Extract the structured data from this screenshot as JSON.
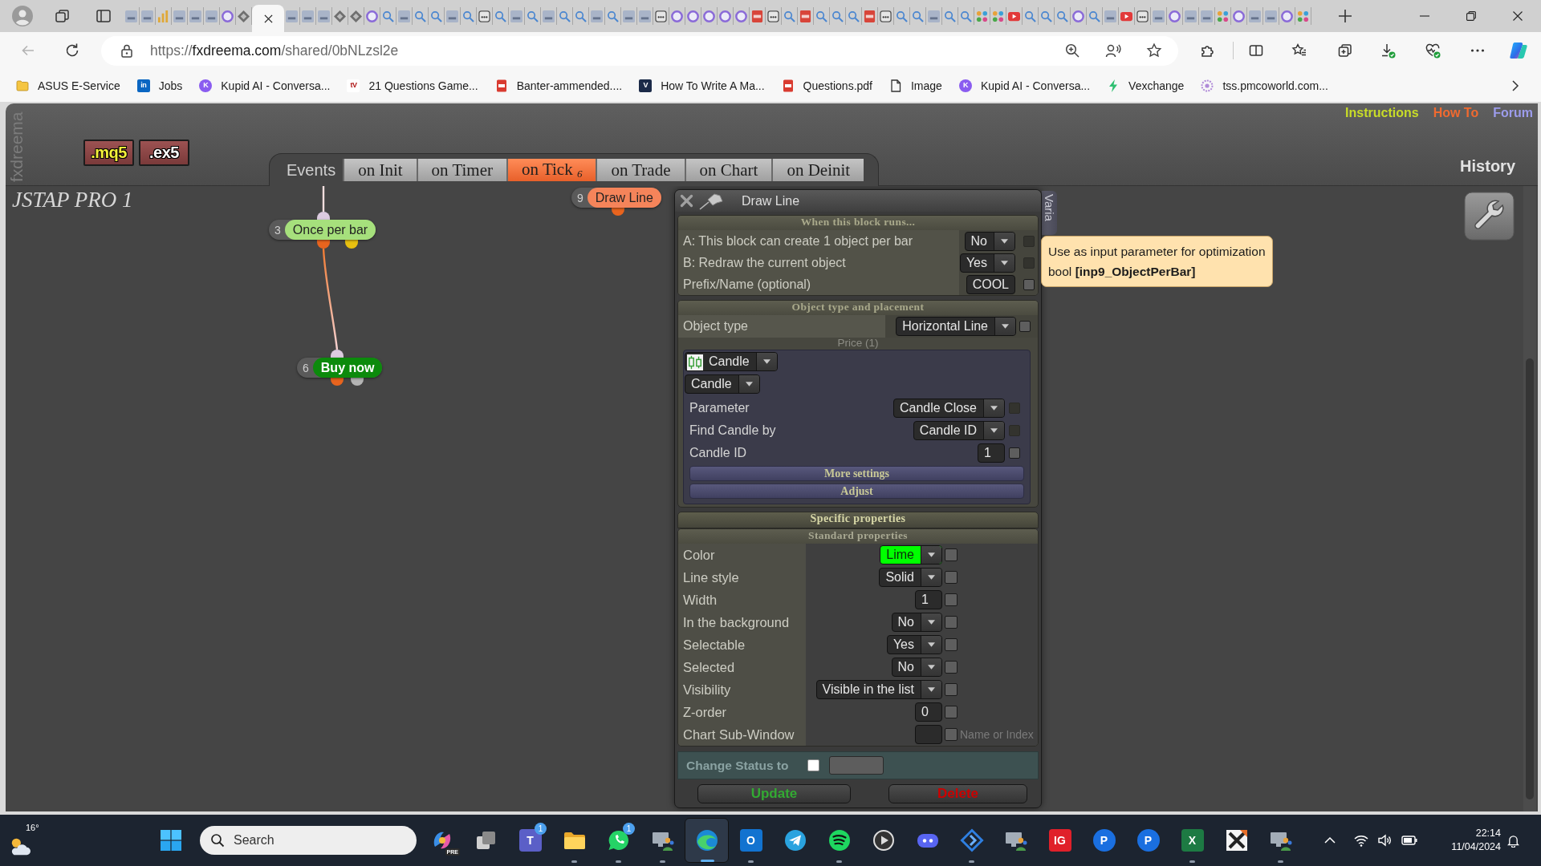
{
  "browser": {
    "tabs": [
      {
        "kind": "tile",
        "selected": false
      },
      {
        "kind": "tile",
        "selected": false
      },
      {
        "kind": "chart",
        "selected": false
      },
      {
        "kind": "tile",
        "selected": false
      },
      {
        "kind": "tile",
        "selected": false
      },
      {
        "kind": "tile",
        "selected": false
      },
      {
        "kind": "ring",
        "selected": false
      },
      {
        "kind": "diamond",
        "selected": false
      },
      {
        "selected": true
      },
      {
        "kind": "tile",
        "selected": false
      },
      {
        "kind": "tile",
        "selected": false
      },
      {
        "kind": "tile",
        "selected": false
      },
      {
        "kind": "diamond",
        "selected": false
      },
      {
        "kind": "diamond",
        "selected": false
      },
      {
        "kind": "ring",
        "selected": false
      },
      {
        "kind": "search",
        "selected": false
      },
      {
        "kind": "tile",
        "selected": false
      },
      {
        "kind": "search",
        "selected": false
      },
      {
        "kind": "search",
        "selected": false
      },
      {
        "kind": "tile",
        "selected": false
      },
      {
        "kind": "search",
        "selected": false
      },
      {
        "kind": "box",
        "selected": false
      },
      {
        "kind": "search",
        "selected": false
      },
      {
        "kind": "tile",
        "selected": false
      },
      {
        "kind": "search",
        "selected": false
      },
      {
        "kind": "tile",
        "selected": false
      },
      {
        "kind": "search",
        "selected": false
      },
      {
        "kind": "search",
        "selected": false
      },
      {
        "kind": "tile",
        "selected": false
      },
      {
        "kind": "search",
        "selected": false
      },
      {
        "kind": "tile",
        "selected": false
      },
      {
        "kind": "tile",
        "selected": false
      },
      {
        "kind": "box",
        "selected": false
      },
      {
        "kind": "ring",
        "selected": false
      },
      {
        "kind": "ring",
        "selected": false
      },
      {
        "kind": "ring",
        "selected": false
      },
      {
        "kind": "ring",
        "selected": false
      },
      {
        "kind": "ring",
        "selected": false
      },
      {
        "kind": "pdf",
        "selected": false
      },
      {
        "kind": "box",
        "selected": false
      },
      {
        "kind": "search",
        "selected": false
      },
      {
        "kind": "pdf",
        "selected": false
      },
      {
        "kind": "search",
        "selected": false
      },
      {
        "kind": "search",
        "selected": false
      },
      {
        "kind": "search",
        "selected": false
      },
      {
        "kind": "pdf",
        "selected": false
      },
      {
        "kind": "box",
        "selected": false
      },
      {
        "kind": "search",
        "selected": false
      },
      {
        "kind": "search",
        "selected": false
      },
      {
        "kind": "tile",
        "selected": false
      },
      {
        "kind": "search",
        "selected": false
      },
      {
        "kind": "search",
        "selected": false
      },
      {
        "kind": "people",
        "selected": false
      },
      {
        "kind": "people",
        "selected": false
      },
      {
        "kind": "video",
        "selected": false
      },
      {
        "kind": "search",
        "selected": false
      },
      {
        "kind": "search",
        "selected": false
      },
      {
        "kind": "search",
        "selected": false
      },
      {
        "kind": "ring",
        "selected": false
      },
      {
        "kind": "search",
        "selected": false
      },
      {
        "kind": "tile",
        "selected": false
      },
      {
        "kind": "video",
        "selected": false
      },
      {
        "kind": "box",
        "selected": false
      },
      {
        "kind": "tile",
        "selected": false
      },
      {
        "kind": "ring",
        "selected": false
      },
      {
        "kind": "tile",
        "selected": false
      },
      {
        "kind": "tile",
        "selected": false
      },
      {
        "kind": "people",
        "selected": false
      },
      {
        "kind": "ring",
        "selected": false
      },
      {
        "kind": "tile",
        "selected": false
      },
      {
        "kind": "tile",
        "selected": false
      },
      {
        "kind": "ring",
        "selected": false
      },
      {
        "kind": "people",
        "selected": false
      }
    ],
    "url": {
      "scheme": "https://",
      "host": "fxdreema.com",
      "path": "/shared/0bNLzsl2e"
    },
    "bookmarks": [
      {
        "kind": "folder",
        "label": "ASUS E-Service"
      },
      {
        "kind": "letter",
        "glyph": "in",
        "color": "#0a66c2",
        "label": "Jobs"
      },
      {
        "kind": "letter_round",
        "glyph": "K",
        "color": "#8a5cf0",
        "label": "Kupid AI - Conversa..."
      },
      {
        "kind": "letter",
        "glyph": "tV",
        "color": "#ffffff",
        "label": "21 Questions Game..."
      },
      {
        "kind": "pdf",
        "label": "Banter-ammended...."
      },
      {
        "kind": "letter",
        "glyph": "V",
        "color": "#1b2a48",
        "label": "How To Write A Ma..."
      },
      {
        "kind": "pdf",
        "label": "Questions.pdf"
      },
      {
        "kind": "file",
        "label": "Image"
      },
      {
        "kind": "letter_round",
        "glyph": "K",
        "color": "#8a5cf0",
        "label": "Kupid AI - Conversa..."
      },
      {
        "kind": "bolt",
        "label": "Vexchange"
      },
      {
        "kind": "ring",
        "label": "tss.pmcoworld.com..."
      }
    ]
  },
  "app": {
    "side_label": "fxdreema",
    "file_buttons": [
      {
        "label": ".mq5",
        "kind": "source"
      },
      {
        "label": ".ex5",
        "kind": "binary"
      }
    ],
    "events": {
      "label": "Events",
      "tabs": [
        {
          "label": "on Init",
          "selected": false
        },
        {
          "label": "on Timer",
          "selected": false
        },
        {
          "label": "on Tick $_{6}$",
          "selected": true
        },
        {
          "label": "on Trade",
          "selected": false
        },
        {
          "label": "on Chart",
          "selected": false
        },
        {
          "label": "on Deinit",
          "selected": false
        }
      ]
    },
    "links": [
      {
        "label": "Instructions",
        "color": "#c8dc28"
      },
      {
        "label": "How To",
        "color": "#f06a30"
      },
      {
        "label": "Forum",
        "color": "#9c9cec"
      }
    ],
    "history": "History",
    "project_title": "JSTAP PRO 1",
    "nodes": [
      {
        "number": "3",
        "label": "Once per bar",
        "color": "#a6e07c"
      },
      {
        "number": "6",
        "label": "Buy now",
        "color": "#0c8a0c"
      },
      {
        "number": "9",
        "label": "Draw Line",
        "color": "#f5845a"
      }
    ],
    "dialog": {
      "title": "Draw Line",
      "side_tab": "Varia",
      "block_runs": {
        "heading": "When this block runs...",
        "rows": [
          {
            "label": "A: This block can create 1 object per bar",
            "kind": "select",
            "value": "No",
            "checkbox": {
              "checked": false,
              "disabled": true
            }
          },
          {
            "label": "B: Redraw the current object",
            "kind": "select",
            "value": "Yes",
            "checkbox": {
              "checked": false,
              "disabled": true
            }
          },
          {
            "label": "Prefix/Name (optional)",
            "kind": "input",
            "value": "COOL",
            "checkbox": {
              "checked": false,
              "disabled": false
            }
          }
        ]
      },
      "placement": {
        "heading": "Object type and placement",
        "object_type": {
          "label": "Object type",
          "kind": "select",
          "value": "Horizontal Line",
          "checkbox": {
            "checked": false,
            "disabled": false
          }
        },
        "price": {
          "label": "Price (1)",
          "source": {
            "kind": "source",
            "value": "Candle"
          },
          "subtype": {
            "kind": "select",
            "value": "Candle"
          },
          "rows": [
            {
              "label": "Parameter",
              "kind": "select",
              "value": "Candle Close",
              "checkbox": {
                "checked": false,
                "disabled": true
              }
            },
            {
              "label": "Find Candle by",
              "kind": "select",
              "value": "Candle ID",
              "checkbox": {
                "checked": false,
                "disabled": true
              }
            },
            {
              "label": "Candle ID",
              "kind": "input",
              "value": "1",
              "checkbox": {
                "checked": false,
                "disabled": false
              }
            }
          ],
          "bars": [
            "More settings",
            "Adjust"
          ]
        }
      },
      "specific_heading": "Specific properties",
      "standard": {
        "heading": "Standard properties",
        "rows": [
          {
            "label": "Color",
            "kind": "select",
            "value": "Lime",
            "color": "#00ff00",
            "checkbox": {
              "checked": false,
              "disabled": false
            }
          },
          {
            "label": "Line style",
            "kind": "select",
            "value": "Solid",
            "checkbox": {
              "checked": false,
              "disabled": false
            }
          },
          {
            "label": "Width",
            "kind": "input",
            "value": "1",
            "checkbox": {
              "checked": false,
              "disabled": false
            }
          },
          {
            "label": "In the background",
            "kind": "select",
            "value": "No",
            "checkbox": {
              "checked": false,
              "disabled": false
            }
          },
          {
            "label": "Selectable",
            "kind": "select",
            "value": "Yes",
            "checkbox": {
              "checked": false,
              "disabled": false
            }
          },
          {
            "label": "Selected",
            "kind": "select",
            "value": "No",
            "checkbox": {
              "checked": false,
              "disabled": false
            }
          },
          {
            "label": "Visibility",
            "kind": "select",
            "value": "Visible in the list",
            "checkbox": {
              "checked": false,
              "disabled": false
            }
          },
          {
            "label": "Z-order",
            "kind": "input",
            "value": "0",
            "checkbox": {
              "checked": false,
              "disabled": false
            }
          },
          {
            "label": "Chart Sub-Window",
            "kind": "input",
            "note": "Name or Index",
            "checkbox": {
              "checked": false,
              "disabled": false
            }
          }
        ]
      },
      "change_status": {
        "label": "Change Status to",
        "checked": false
      },
      "buttons": [
        {
          "label": "Update",
          "kind": "update"
        },
        {
          "label": "Delete",
          "kind": "delete"
        }
      ]
    },
    "tooltip": {
      "lines": [
        "Use as input parameter for optimization",
        "bool **[inp9_ObjectPerBar]**"
      ]
    }
  },
  "taskbar": {
    "weather": "16°",
    "search": {
      "placeholder": "Search"
    },
    "apps": [
      {
        "kind": "swirl",
        "badge": {
          "text": "PRE",
          "kind": "label"
        },
        "running": false,
        "selected": false
      },
      {
        "kind": "windows",
        "running": false,
        "selected": false
      },
      {
        "kind": "letter",
        "glyph": "T",
        "color": "#5b5fc7",
        "badge": {
          "text": "1",
          "kind": "count"
        },
        "running": false,
        "selected": false
      },
      {
        "kind": "folder",
        "running": true,
        "selected": false
      },
      {
        "kind": "chat",
        "badge": {
          "text": "1",
          "kind": "count"
        },
        "running": true,
        "selected": false
      },
      {
        "kind": "remote",
        "running": true,
        "selected": false
      },
      {
        "kind": "browser",
        "running": true,
        "selected": true
      },
      {
        "kind": "letter",
        "glyph": "O",
        "color": "#1273d0",
        "running": true,
        "selected": false
      },
      {
        "kind": "plane",
        "running": false,
        "selected": false
      },
      {
        "kind": "waves",
        "running": true,
        "selected": false
      },
      {
        "kind": "play",
        "running": false,
        "selected": false
      },
      {
        "kind": "controller",
        "running": false,
        "selected": false
      },
      {
        "kind": "diamond",
        "running": true,
        "selected": false
      },
      {
        "kind": "remote",
        "running": false,
        "selected": false
      },
      {
        "kind": "letter",
        "glyph": "IG",
        "color": "#e0202a",
        "running": false,
        "selected": false
      },
      {
        "kind": "letter_round",
        "glyph": "P",
        "color": "#1a6fe0",
        "running": false,
        "selected": false
      },
      {
        "kind": "letter_round",
        "glyph": "P",
        "color": "#1a6fe0",
        "running": false,
        "selected": false
      },
      {
        "kind": "letter",
        "glyph": "X",
        "color": "#1d7a43",
        "running": true,
        "selected": false
      },
      {
        "kind": "cross",
        "running": false,
        "selected": false
      },
      {
        "kind": "remote",
        "running": true,
        "selected": false
      }
    ],
    "time": "22:14",
    "date": "11/04/2024"
  }
}
